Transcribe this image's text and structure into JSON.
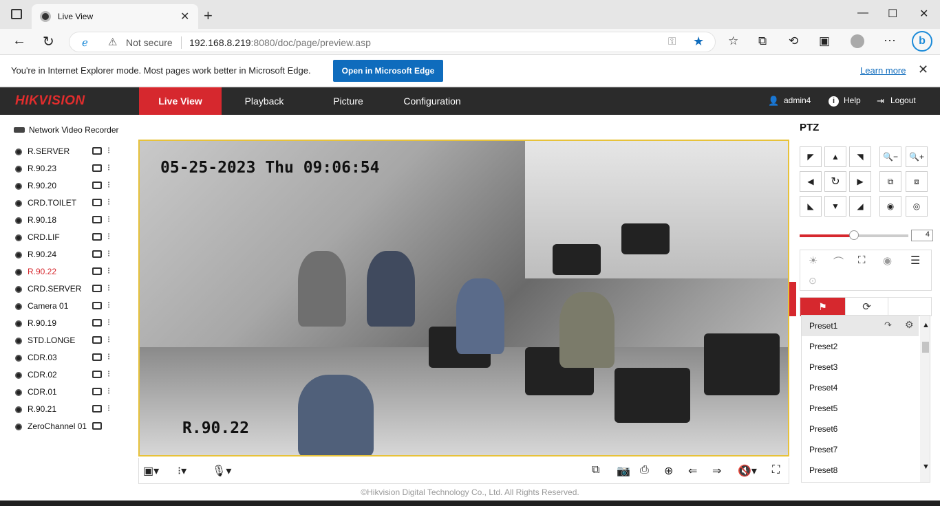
{
  "browser": {
    "tab_title": "Live View",
    "tab_close": "✕",
    "new_tab": "+",
    "address_not_secure": "Not secure",
    "address_host": "192.168.8.219",
    "address_rest": ":8080/doc/page/preview.asp",
    "ie_message": "You're in Internet Explorer mode. Most pages work better in Microsoft Edge.",
    "ie_button": "Open in Microsoft Edge",
    "ie_learn": "Learn more"
  },
  "header": {
    "logo": "HIKVISION",
    "nav": [
      "Live View",
      "Playback",
      "Picture",
      "Configuration"
    ],
    "user": "admin4",
    "help": "Help",
    "logout": "Logout"
  },
  "tree": {
    "device": "Network Video Recorder",
    "cameras": [
      "R.SERVER",
      "R.90.23",
      "R.90.20",
      "CRD.TOILET",
      "R.90.18",
      "CRD.LIF",
      "R.90.24",
      "R.90.22",
      "CRD.SERVER",
      "Camera 01",
      "R.90.19",
      "STD.LONGE",
      "CDR.03",
      "CDR.02",
      "CDR.01",
      "R.90.21",
      "ZeroChannel 01"
    ],
    "active_index": 7
  },
  "video": {
    "timestamp": "05-25-2023 Thu 09:06:54",
    "camera_name": "R.90.22"
  },
  "footer": "©Hikvision Digital Technology Co., Ltd. All Rights Reserved.",
  "ptz": {
    "title": "PTZ",
    "speed": "4",
    "speed_fraction": 0.5,
    "presets": [
      "Preset1",
      "Preset2",
      "Preset3",
      "Preset4",
      "Preset5",
      "Preset6",
      "Preset7",
      "Preset8"
    ]
  },
  "colors": {
    "accent": "#d6282e",
    "edge_blue": "#0f6cbd",
    "header_bg": "#2b2b2b"
  }
}
